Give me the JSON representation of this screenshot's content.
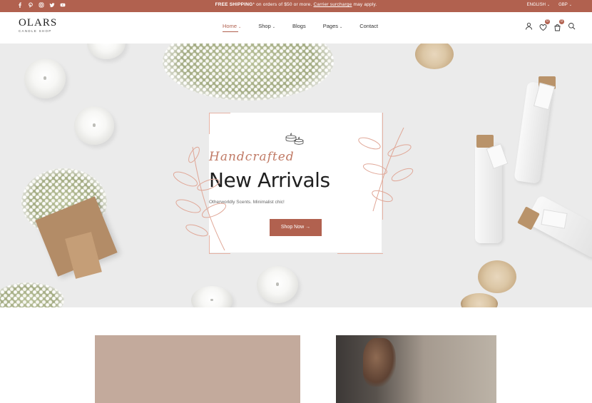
{
  "topbar": {
    "socials": [
      "facebook-icon",
      "pinterest-icon",
      "instagram-icon",
      "twitter-icon",
      "youtube-icon"
    ],
    "promo_strong": "FREE SHIPPING",
    "promo_text": "* on orders of $50 or more.",
    "promo_link": "Carrier surcharge",
    "promo_tail": "may apply.",
    "language": "ENGLISH",
    "currency": "GBP"
  },
  "header": {
    "logo": "OLARS",
    "logo_sub": "CANDLE SHOP",
    "nav": [
      "Home",
      "Shop",
      "Blogs",
      "Pages",
      "Contact"
    ],
    "wishlist_count": "0",
    "cart_count": "0"
  },
  "hero": {
    "script": "Handcrafted",
    "title": "New Arrivals",
    "subtitle": "Otherworldly Scents. Minimalist chic!",
    "button": "Shop Now"
  },
  "colors": {
    "accent": "#b1614f",
    "hero_bg": "#ebebeb",
    "frame": "#e6b3a4"
  }
}
